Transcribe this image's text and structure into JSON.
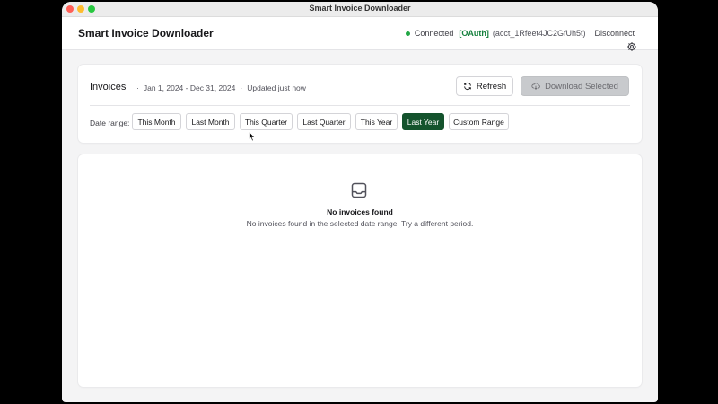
{
  "window": {
    "title": "Smart Invoice Downloader"
  },
  "header": {
    "app_title": "Smart Invoice Downloader",
    "status_text": "Connected",
    "auth_badge": "[OAuth]",
    "account_id": "(acct_1Rfeet4JC2GfUh5t)",
    "disconnect_label": "Disconnect",
    "status_color": "#22a745"
  },
  "invoices": {
    "title": "Invoices",
    "date_span": "Jan 1, 2024 - Dec 31, 2024",
    "updated": "Updated just now",
    "refresh_label": "Refresh",
    "download_label": "Download Selected",
    "range_label": "Date range:",
    "ranges": [
      {
        "label": "This Month",
        "active": false
      },
      {
        "label": "Last Month",
        "active": false
      },
      {
        "label": "This Quarter",
        "active": false
      },
      {
        "label": "Last Quarter",
        "active": false
      },
      {
        "label": "This Year",
        "active": false
      },
      {
        "label": "Last Year",
        "active": true
      },
      {
        "label": "Custom Range",
        "active": false
      }
    ],
    "accent_color": "#14532d"
  },
  "empty_state": {
    "icon": "inbox-icon",
    "title": "No invoices found",
    "message": "No invoices found in the selected date range. Try a different period."
  }
}
